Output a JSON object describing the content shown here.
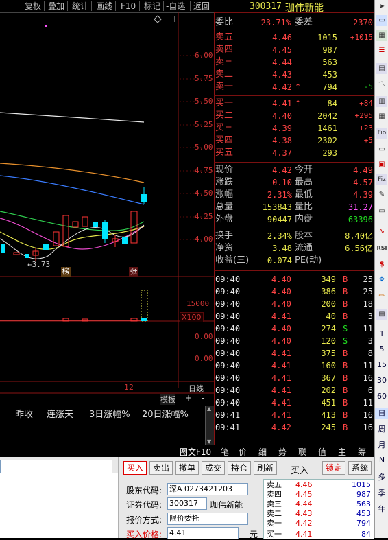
{
  "toolbar": {
    "items": [
      "复权",
      "叠加",
      "统计",
      "画线",
      "F10",
      "标记",
      "-自选",
      "返回"
    ]
  },
  "chart": {
    "price_ticks": [
      "6.00",
      "5.75",
      "5.50",
      "5.25",
      "5.00",
      "4.75",
      "4.50",
      "4.25",
      "4.00"
    ],
    "low_label": "3.73",
    "badge_bang": "榜",
    "badge_zhang": "张",
    "vol_tick": "15000",
    "vol_unit": "X100",
    "ind_tick_1": "0.00",
    "ind_tick_2": "0.00",
    "period_label": "日线",
    "date_label": "12",
    "board_label": "模板",
    "plus": "+",
    "minus": "-",
    "cols": [
      "昨收",
      "连涨天",
      "3日涨幅%",
      "20日涨幅%"
    ],
    "bottom_tabs": [
      "图文F10",
      "笔",
      "价",
      "细",
      "势",
      "联",
      "值",
      "主",
      "筹"
    ]
  },
  "quote": {
    "code": "300317",
    "name": "珈伟新能",
    "weibi_label": "委比",
    "weibi_val": "23.71%",
    "weicha_label": "委差",
    "weicha_val": "2370",
    "asks": [
      {
        "label": "卖五",
        "price": "4.46",
        "vol": "1015",
        "chg": "+1015"
      },
      {
        "label": "卖四",
        "price": "4.45",
        "vol": "987",
        "chg": ""
      },
      {
        "label": "卖三",
        "price": "4.44",
        "vol": "563",
        "chg": ""
      },
      {
        "label": "卖二",
        "price": "4.43",
        "vol": "453",
        "chg": ""
      },
      {
        "label": "卖一",
        "price": "4.42",
        "vol": "794",
        "chg": "-5"
      }
    ],
    "bids": [
      {
        "label": "买一",
        "price": "4.41",
        "vol": "84",
        "chg": "+84"
      },
      {
        "label": "买二",
        "price": "4.40",
        "vol": "2042",
        "chg": "+295"
      },
      {
        "label": "买三",
        "price": "4.39",
        "vol": "1461",
        "chg": "+23"
      },
      {
        "label": "买四",
        "price": "4.38",
        "vol": "2302",
        "chg": "+5"
      },
      {
        "label": "买五",
        "price": "4.37",
        "vol": "293",
        "chg": ""
      }
    ],
    "stats": {
      "xianjia_l": "现价",
      "xianjia": "4.42",
      "jinkai_l": "今开",
      "jinkai": "4.49",
      "zhangdie_l": "涨跌",
      "zhangdie": "0.10",
      "zuigao_l": "最高",
      "zuigao": "4.57",
      "zhangfu_l": "涨幅",
      "zhangfu": "2.31%",
      "zuidi_l": "最低",
      "zuidi": "4.39",
      "zongliang_l": "总量",
      "zongliang": "153843",
      "liangbi_l": "量比",
      "liangbi": "31.27",
      "waipan_l": "外盘",
      "waipan": "90447",
      "neipan_l": "内盘",
      "neipan": "63396",
      "huanshou_l": "换手",
      "huanshou": "2.34%",
      "guben_l": "股本",
      "guben": "8.40亿",
      "jingzi_l": "净资",
      "jingzi": "3.48",
      "liutong_l": "流通",
      "liutong": "6.56亿",
      "shouyi_l": "收益(三)",
      "shouyi": "-0.074",
      "pe_l": "PE(动)",
      "pe": "-"
    },
    "ticks": [
      {
        "t": "09:40",
        "p": "4.40",
        "v": "349",
        "s": "B",
        "n": "25"
      },
      {
        "t": "09:40",
        "p": "4.40",
        "v": "386",
        "s": "B",
        "n": "25"
      },
      {
        "t": "09:40",
        "p": "4.40",
        "v": "200",
        "s": "B",
        "n": "18"
      },
      {
        "t": "09:40",
        "p": "4.41",
        "v": "40",
        "s": "B",
        "n": "3"
      },
      {
        "t": "09:40",
        "p": "4.40",
        "v": "274",
        "s": "S",
        "n": "11"
      },
      {
        "t": "09:40",
        "p": "4.40",
        "v": "120",
        "s": "S",
        "n": "3"
      },
      {
        "t": "09:40",
        "p": "4.41",
        "v": "375",
        "s": "B",
        "n": "8"
      },
      {
        "t": "09:40",
        "p": "4.41",
        "v": "160",
        "s": "B",
        "n": "11"
      },
      {
        "t": "09:40",
        "p": "4.41",
        "v": "367",
        "s": "B",
        "n": "16"
      },
      {
        "t": "09:40",
        "p": "4.41",
        "v": "202",
        "s": "B",
        "n": "6"
      },
      {
        "t": "09:40",
        "p": "4.41",
        "v": "451",
        "s": "B",
        "n": "11"
      },
      {
        "t": "09:41",
        "p": "4.41",
        "v": "413",
        "s": "B",
        "n": "16"
      },
      {
        "t": "09:41",
        "p": "4.42",
        "v": "245",
        "s": "B",
        "n": "16"
      }
    ]
  },
  "sidebar": {
    "icons": [
      "Fiz",
      "RSI",
      "$"
    ],
    "nums": [
      "1",
      "5",
      "15",
      "30",
      "60",
      "日",
      "周",
      "月",
      "N",
      "多",
      "季",
      "年"
    ]
  },
  "trade": {
    "tabs": [
      "买入",
      "卖出",
      "撤单",
      "成交",
      "持仓",
      "刷新"
    ],
    "mode": "买入",
    "lock": "锁定",
    "system": "系统",
    "holder_l": "股东代码:",
    "holder_v": "深A  0273421203",
    "code_l": "证券代码:",
    "code_v": "300317",
    "name_v": "珈伟新能",
    "quote_l": "报价方式:",
    "quote_v": "限价委托",
    "price_l": "买入价格:",
    "price_v": "4.41",
    "unit": "元",
    "book": [
      {
        "l": "卖五",
        "p": "4.46",
        "v": "1015"
      },
      {
        "l": "卖四",
        "p": "4.45",
        "v": "987"
      },
      {
        "l": "卖三",
        "p": "4.44",
        "v": "563"
      },
      {
        "l": "卖二",
        "p": "4.43",
        "v": "453"
      },
      {
        "l": "卖一",
        "p": "4.42",
        "v": "794"
      },
      {
        "l": "买一",
        "p": "4.41",
        "v": "84"
      }
    ]
  }
}
